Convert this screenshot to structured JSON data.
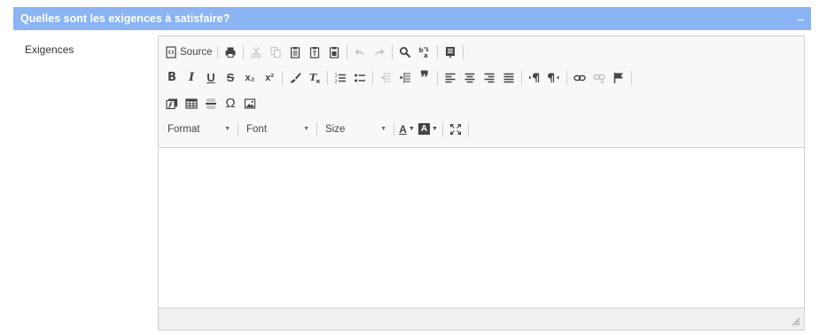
{
  "panel": {
    "title": "Quelles sont les exigences à satisfaire?",
    "collapse_symbol": "–"
  },
  "field": {
    "label": "Exigences"
  },
  "toolbar": {
    "source_label": "Source",
    "bold": "B",
    "italic": "I",
    "underline": "U",
    "strike": "S",
    "subscript": "x₂",
    "superscript": "x²",
    "remove_format": "T",
    "blockquote": "❞",
    "omega": "Ω",
    "format": "Format",
    "font": "Font",
    "size": "Size",
    "text_color": "A",
    "bg_color": "A"
  },
  "colors": {
    "header": "#8ab4f4",
    "border": "#d1d1d1",
    "toolbar_bg": "#f8f8f8"
  }
}
